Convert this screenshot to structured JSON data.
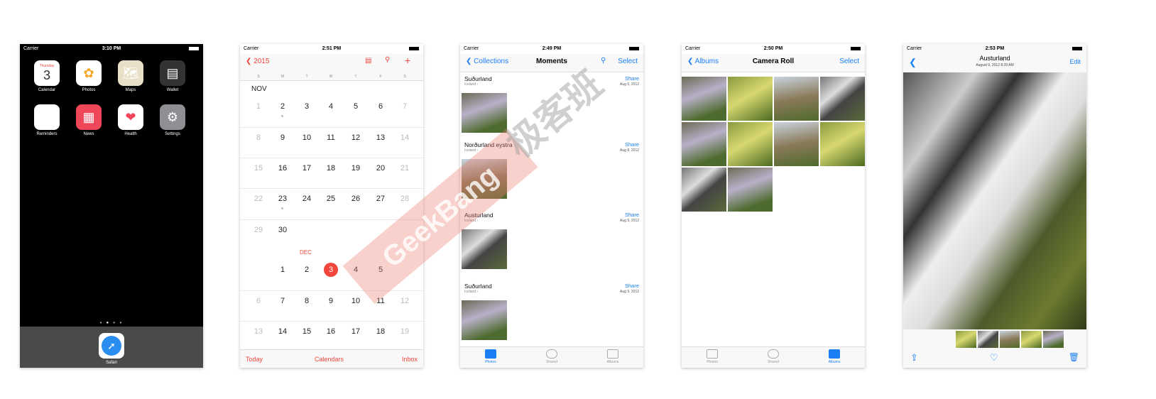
{
  "home": {
    "carrier": "Carrier",
    "time": "3:10 PM",
    "calendar_day": "Thursday",
    "calendar_date": "3",
    "apps": [
      {
        "label": "Calendar",
        "icon": "calendar-icon"
      },
      {
        "label": "Photos",
        "icon": "photos-icon"
      },
      {
        "label": "Maps",
        "icon": "maps-icon"
      },
      {
        "label": "Wallet",
        "icon": "wallet-icon"
      },
      {
        "label": "Reminders",
        "icon": "reminders-icon"
      },
      {
        "label": "News",
        "icon": "news-icon"
      },
      {
        "label": "Health",
        "icon": "health-icon"
      },
      {
        "label": "Settings",
        "icon": "settings-icon"
      }
    ],
    "dock": [
      {
        "label": "Safari",
        "icon": "safari-icon"
      }
    ]
  },
  "calendar": {
    "carrier": "Carrier",
    "time": "2:51 PM",
    "back": "2015",
    "weekdays": [
      "S",
      "M",
      "T",
      "W",
      "T",
      "F",
      "S"
    ],
    "months": [
      {
        "name": "NOV",
        "weeks": [
          [
            "1",
            "2",
            "3",
            "4",
            "5",
            "6",
            "7"
          ],
          [
            "8",
            "9",
            "10",
            "11",
            "12",
            "13",
            "14"
          ],
          [
            "15",
            "16",
            "17",
            "18",
            "19",
            "20",
            "21"
          ],
          [
            "22",
            "23",
            "24",
            "25",
            "26",
            "27",
            "28"
          ],
          [
            "29",
            "30",
            "",
            "",
            "",
            "",
            ""
          ]
        ]
      },
      {
        "name": "DEC",
        "weeks": [
          [
            "",
            "1",
            "2",
            "3",
            "4",
            "5",
            ""
          ],
          [
            "6",
            "7",
            "8",
            "9",
            "10",
            "11",
            "12"
          ],
          [
            "13",
            "14",
            "15",
            "16",
            "17",
            "18",
            "19"
          ]
        ]
      }
    ],
    "today": "3",
    "toolbar": {
      "today": "Today",
      "calendars": "Calendars",
      "inbox": "Inbox"
    },
    "accent": "#f0463c"
  },
  "moments": {
    "carrier": "Carrier",
    "time": "2:49 PM",
    "back": "Collections",
    "title": "Moments",
    "select": "Select",
    "sections": [
      {
        "title": "Suðurland",
        "sub": "Iceland",
        "share": "Share",
        "date": "Aug 6, 2012"
      },
      {
        "title": "Norðurland eystra",
        "sub": "Iceland",
        "share": "Share",
        "date": "Aug 8, 2012"
      },
      {
        "title": "Austurland",
        "sub": "Iceland",
        "share": "Share",
        "date": "Aug 9, 2012"
      },
      {
        "title": "Suðurland",
        "sub": "Iceland",
        "share": "Share",
        "date": "Aug 9, 2012"
      }
    ],
    "tabs": [
      "Photos",
      "Shared",
      "Albums"
    ],
    "active_tab": "Photos"
  },
  "camera_roll": {
    "carrier": "Carrier",
    "time": "2:50 PM",
    "back": "Albums",
    "title": "Camera Roll",
    "select": "Select",
    "photo_count": 10,
    "tabs": [
      "Photos",
      "Shared",
      "Albums"
    ],
    "active_tab": "Albums"
  },
  "detail": {
    "carrier": "Carrier",
    "time": "2:53 PM",
    "title": "Austurland",
    "subtitle": "August 9, 2012  8:29 AM",
    "edit": "Edit"
  },
  "watermark": {
    "text_en": "GeekBang",
    "text_cn": "极客班"
  },
  "accent_blue": "#1a7ff5"
}
